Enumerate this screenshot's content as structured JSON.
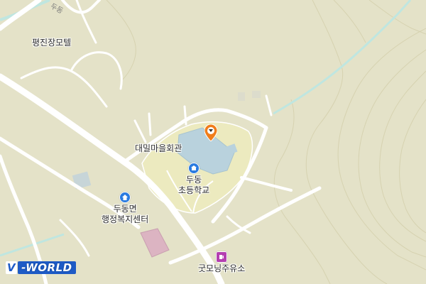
{
  "map": {
    "labels": {
      "motel": "평진장모텔",
      "village_hall": "대밀마을회관",
      "school_line1": "두동",
      "school_line2": "초등학교",
      "office_line1": "두동면",
      "office_line2": "행정복지센터",
      "gas_station": "굿모닝주유소",
      "road": "두동"
    },
    "icons": {
      "school": "school-icon",
      "office": "home-icon",
      "gas_station": "gas-station-icon",
      "location_marker": "location-pin-icon"
    },
    "colors": {
      "land": "#e4e2c8",
      "road": "#ffffff",
      "school_area": "#eceabf",
      "building": "#b9d2dd",
      "building_pink": "#dcb4c2",
      "river": "#bfe6e0",
      "marker": "#f07d1a",
      "school_icon": "#2a7be0",
      "office_icon": "#2a7be0",
      "gas_icon": "#b43fb0"
    }
  },
  "logo": {
    "prefix": "V",
    "text": "-WORLD"
  }
}
